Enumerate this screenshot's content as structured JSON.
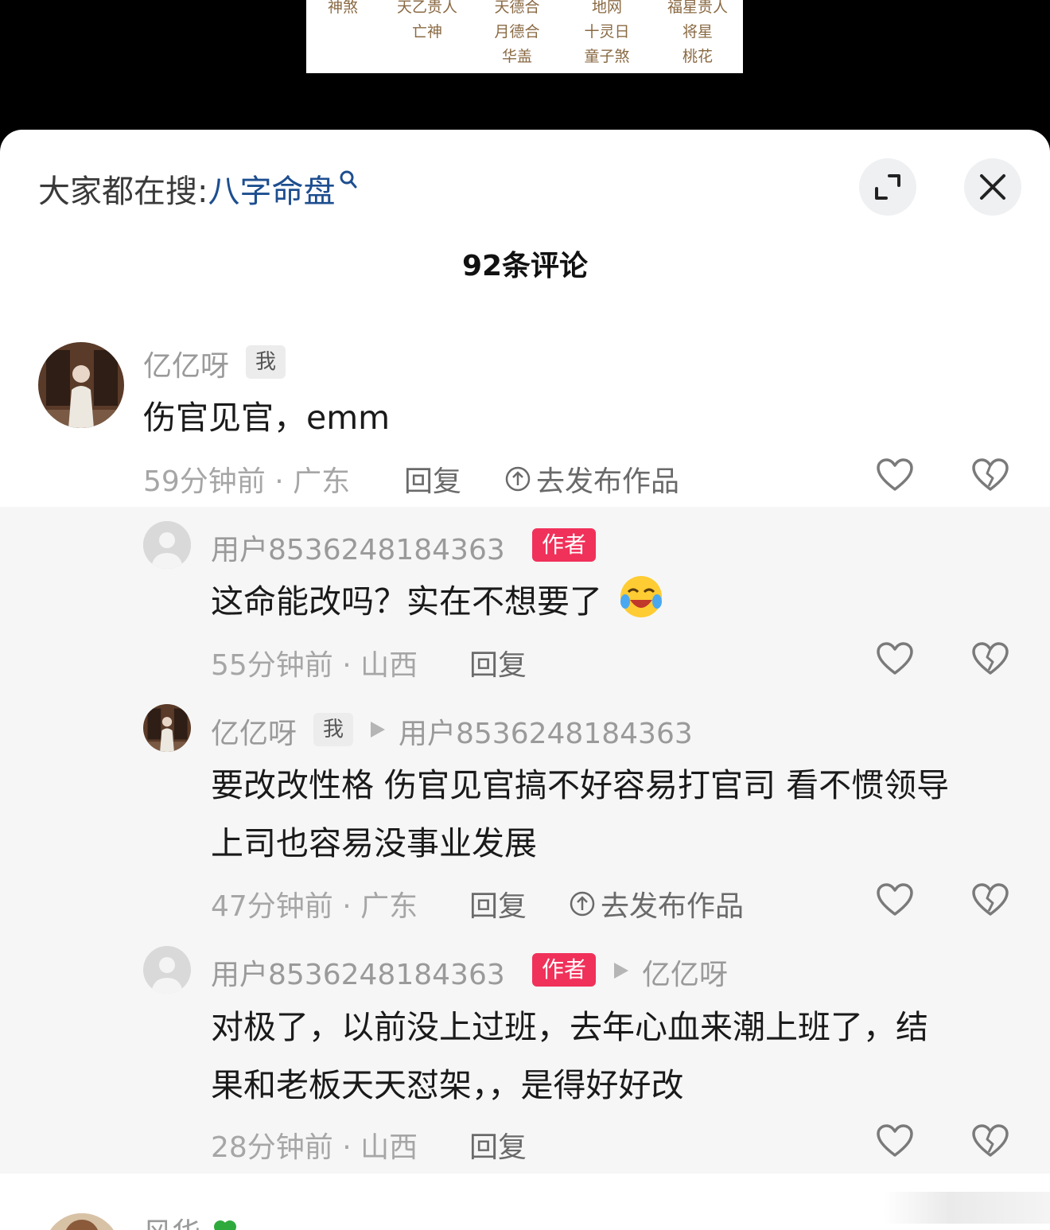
{
  "chart_strip": {
    "columns": [
      [
        "神煞"
      ],
      [
        "天乙贵人",
        "亡神"
      ],
      [
        "天德合",
        "月德合",
        "华盖"
      ],
      [
        "地网",
        "十灵日",
        "童子煞"
      ],
      [
        "福星贵人",
        "将星",
        "桃花"
      ]
    ]
  },
  "header": {
    "search_prefix": "大家都在搜:",
    "search_term": "八字命盘",
    "comment_count": "92条评论"
  },
  "comments": [
    {
      "username": "亿亿呀",
      "badge": "我",
      "text": "伤官见官，emm",
      "meta": "59分钟前 · 广东",
      "reply_label": "回复",
      "publish_label": "去发布作品"
    }
  ],
  "replies": [
    {
      "username": "用户8536248184363",
      "badge": "作者",
      "text": "这命能改吗？实在不想要了",
      "meta": "55分钟前 · 山西",
      "reply_label": "回复"
    },
    {
      "username": "亿亿呀",
      "badge": "我",
      "reply_to": "用户8536248184363",
      "text_lines": [
        "要改改性格 伤官见官搞不好容易打官司 看不惯领导",
        "上司也容易没事业发展"
      ],
      "meta": "47分钟前 · 广东",
      "reply_label": "回复",
      "publish_label": "去发布作品"
    },
    {
      "username": "用户8536248184363",
      "badge": "作者",
      "reply_to": "亿亿呀",
      "text_lines": [
        "对极了，以前没上过班，去年心血来潮上班了，结",
        "果和老板天天怼架，，是得好好改"
      ],
      "meta": "28分钟前 · 山西",
      "reply_label": "回复"
    }
  ],
  "next_comment": {
    "username": "风华"
  },
  "colors": {
    "author_badge": "#f0315a",
    "search_term": "#1d4e8f"
  }
}
